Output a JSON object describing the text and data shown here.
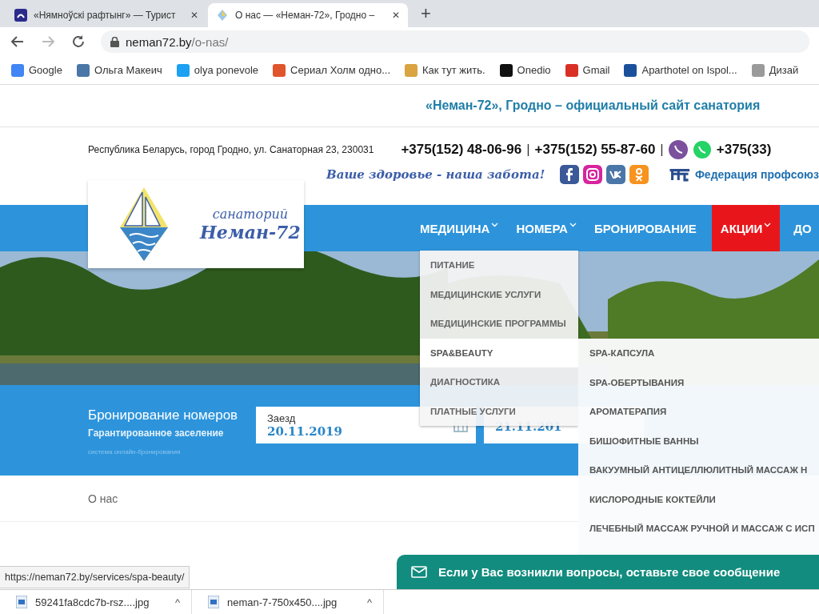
{
  "browser": {
    "tabs": [
      {
        "title": "«Нямноўскі рафтынг» — Турист",
        "selected": false,
        "close": "✕"
      },
      {
        "title": "О нас — «Неман-72», Гродно –",
        "selected": true,
        "close": "✕"
      }
    ],
    "new_tab": "+",
    "address": {
      "host": "neman72.by",
      "path": "/o-nas/"
    },
    "bookmarks": [
      {
        "label": "Google",
        "color": "#4285f4"
      },
      {
        "label": "Ольга Макеич",
        "color": "#4a76a8"
      },
      {
        "label": "olya ponevole",
        "color": "#1da1f2"
      },
      {
        "label": "Сериал Холм одно...",
        "color": "#e0552b"
      },
      {
        "label": "Как тут жить.",
        "color": "#d9a441"
      },
      {
        "label": "Onedio",
        "color": "#111111"
      },
      {
        "label": "Gmail",
        "color": "#d93025"
      },
      {
        "label": "Aparthotel on Ispol...",
        "color": "#1a4f9c"
      },
      {
        "label": "Дизай",
        "color": "#9a9a9a"
      }
    ]
  },
  "site": {
    "top_title": "«Неман-72», Гродно – официальный сайт санатория",
    "address": "Республика Беларусь, город Гродно, ул. Санаторная 23, 230031",
    "phones": [
      "+375(152) 48-06-96",
      "+375(152) 55-87-60",
      "+375(33)"
    ],
    "separator": "|",
    "slogan": "Ваше здоровье - наша забота!",
    "federation": "Федерация профсоюз",
    "logo": {
      "line1": "санаторий",
      "line2": "Неман-72"
    },
    "nav": [
      {
        "label": "МЕДИЦИНА",
        "has_submenu": true,
        "highlight": false
      },
      {
        "label": "НОМЕРА",
        "has_submenu": true,
        "highlight": false
      },
      {
        "label": "БРОНИРОВАНИЕ",
        "has_submenu": false,
        "highlight": false
      },
      {
        "label": "АКЦИИ",
        "has_submenu": true,
        "highlight": true
      },
      {
        "label": "ДО",
        "has_submenu": false,
        "highlight": false
      }
    ],
    "menu": [
      {
        "label": "ПИТАНИЕ",
        "selected": false
      },
      {
        "label": "МЕДИЦИНСКИЕ УСЛУГИ",
        "selected": false
      },
      {
        "label": "МЕДИЦИНСКИЕ ПРОГРАММЫ",
        "selected": false
      },
      {
        "label": "SPA&BEAUTY",
        "selected": true
      },
      {
        "label": "ДИАГНОСТИКА",
        "selected": false
      },
      {
        "label": "ПЛАТНЫЕ УСЛУГИ",
        "selected": false
      }
    ],
    "submenu": [
      "SPA-КАПСУЛА",
      "SPA-ОБЕРТЫВАНИЯ",
      "АРОМАТЕРАПИЯ",
      "БИШОФИТНЫЕ ВАННЫ",
      "ВАКУУМНЫЙ АНТИЦЕЛЛЮЛИТНЫЙ МАССАЖ Н",
      "КИСЛОРОДНЫЕ КОКТЕЙЛИ",
      "ЛЕЧЕБНЫЙ МАССАЖ РУЧНОЙ И МАССАЖ С ИСП"
    ],
    "booking": {
      "title": "Бронирование номеров",
      "subtitle": "Гарантированное заселение",
      "note": "система онлайн-бронирования",
      "checkin": {
        "label": "Заезд",
        "value": "20.11.2019"
      },
      "checkout": {
        "value": "21.11.201"
      }
    },
    "breadcrumb": "О нас",
    "chat": "Если у Вас возникли вопросы, оставьте свое сообщение"
  },
  "status_url": "https://neman72.by/services/spa-beauty/",
  "downloads": [
    {
      "name": "59241fa8cdc7b-rsz....jpg",
      "caret": "^"
    },
    {
      "name": "neman-7-750x450....jpg",
      "caret": "^"
    }
  ]
}
